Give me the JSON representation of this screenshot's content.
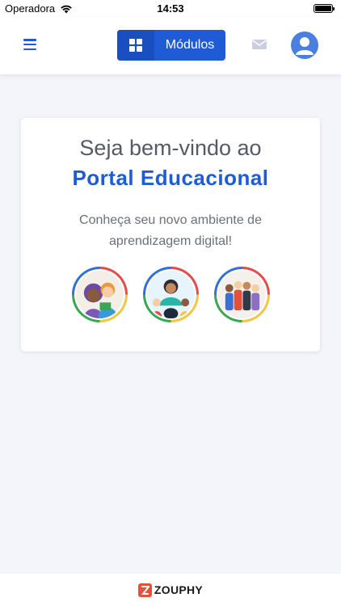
{
  "status_bar": {
    "carrier": "Operadora",
    "time": "14:53",
    "battery_level": 1.0
  },
  "nav": {
    "modules_label": "Módulos",
    "menu_icon": "hamburger-icon",
    "modules_icon": "grid-icon",
    "mail_icon": "mail-icon",
    "profile_icon": "user-icon"
  },
  "welcome": {
    "line1": "Seja bem-vindo ao",
    "line2": "Portal Educacional",
    "description": "Conheça seu novo ambiente de aprendizagem digital!"
  },
  "footer": {
    "brand": "ZOUPHY"
  },
  "colors": {
    "primary": "#1f5bd6",
    "background": "#f4f5fa",
    "ring": [
      "#e54b4b",
      "#f5c542",
      "#3aa655",
      "#2f6fe0"
    ],
    "brand_accent": "#e8503a"
  }
}
